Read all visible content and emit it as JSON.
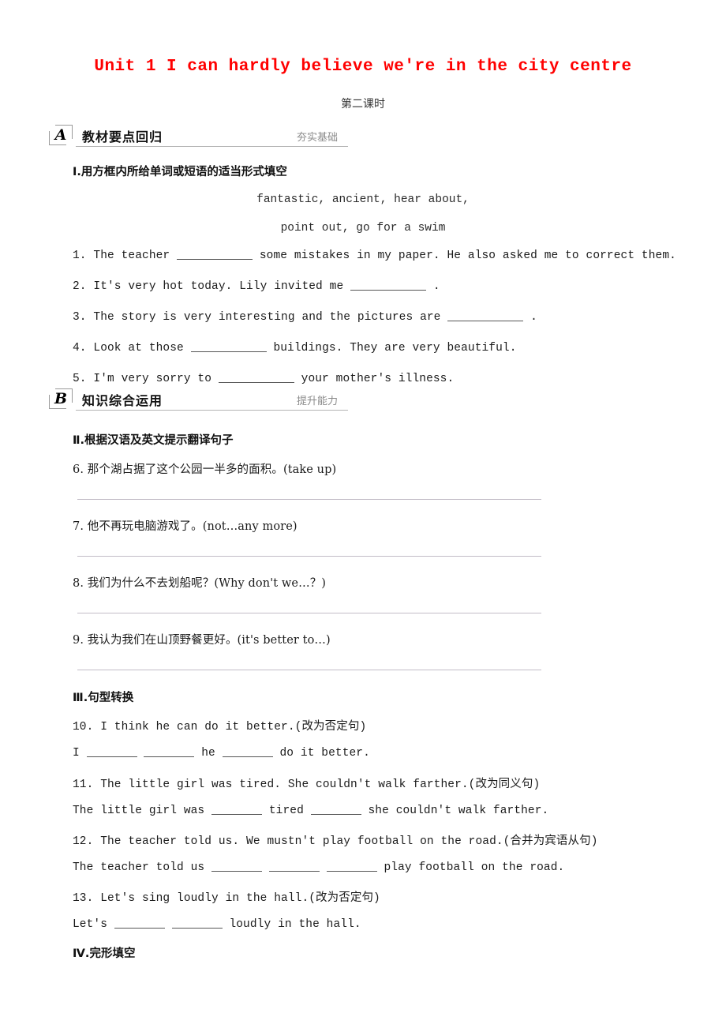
{
  "document": {
    "title": "Unit 1 I can hardly believe we're in the city centre",
    "lesson_label": "第二课时",
    "title_color": "#ff0000"
  },
  "sections": [
    {
      "badge": "A",
      "title": "教材要点回归",
      "subtitle": "夯实基础"
    },
    {
      "badge": "B",
      "title": "知识综合运用",
      "subtitle": "提升能力"
    }
  ],
  "parts": {
    "one": "Ⅰ.用方框内所给单词或短语的适当形式填空",
    "two": "Ⅱ.根据汉语及英文提示翻译句子",
    "three": "Ⅲ.句型转换",
    "four": "Ⅳ.完形填空"
  },
  "wordbank": {
    "line1": "fantastic, ancient, hear about,",
    "line2": "point out, go for a swim"
  },
  "fill_in_blanks": {
    "q1_a": "1. The teacher",
    "q1_b": "some mistakes in my paper. He also asked me to correct them.",
    "q2_a": "2. It's very hot today. Lily invited me",
    "q2_b": ".",
    "q3_a": "3. The story is very interesting and the pictures are",
    "q3_b": ".",
    "q4_a": "4. Look at those",
    "q4_b": "buildings. They are very beautiful.",
    "q5_a": "5. I'm very sorry to",
    "q5_b": "your mother's illness."
  },
  "translation": {
    "q6": "6. 那个湖占据了这个公园一半多的面积。(take up)",
    "q7": "7. 他不再玩电脑游戏了。(not…any more)",
    "q8": "8. 我们为什么不去划船呢？(Why don't we…？)",
    "q9": "9. 我认为我们在山顶野餐更好。(it's better to…)"
  },
  "transform": {
    "q10": "10. I think he can do it better.(改为否定句)",
    "q10_ans_a": "I",
    "q10_ans_b": "he",
    "q10_ans_c": "do it better.",
    "q11": "11. The little girl was tired. She couldn't walk farther.(改为同义句)",
    "q11_ans_a": "The little girl was",
    "q11_ans_b": "tired",
    "q11_ans_c": "she couldn't walk farther.",
    "q12": "12. The teacher told us. We mustn't play football on the road.(合并为宾语从句)",
    "q12_ans_a": "The teacher told us",
    "q12_ans_b": "play football on the road.",
    "q13": "13. Let's sing loudly in the hall.(改为否定句)",
    "q13_ans_a": "Let's",
    "q13_ans_b": "loudly in the hall."
  }
}
